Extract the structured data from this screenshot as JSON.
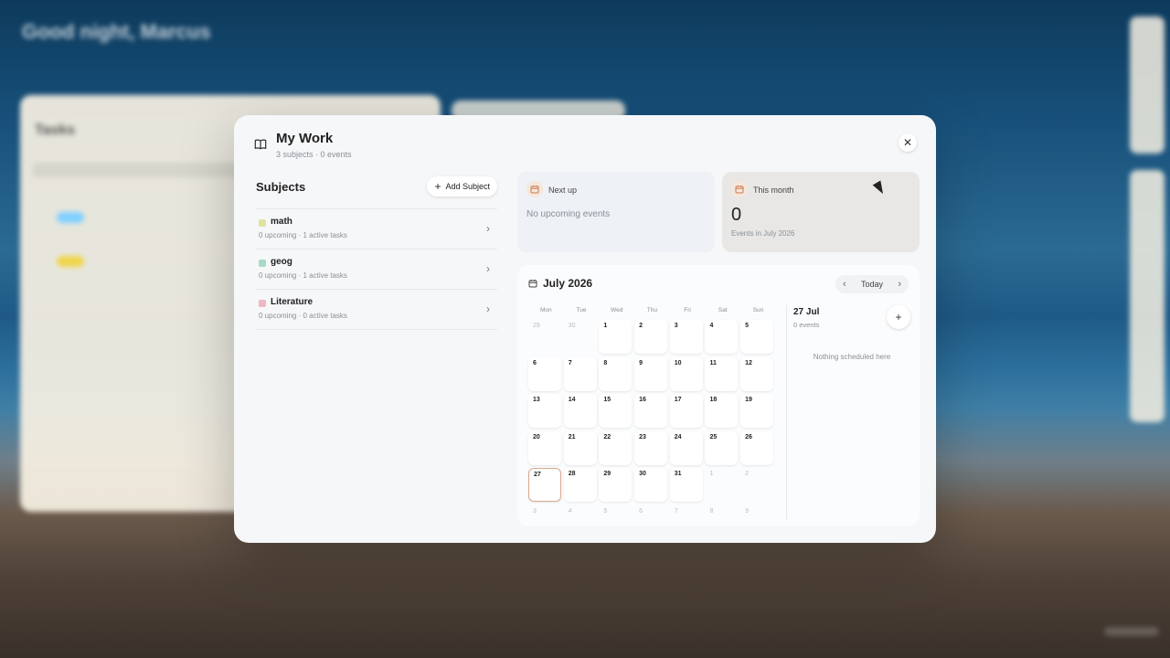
{
  "background": {
    "greeting": "Good night, Marcus",
    "subtitle": "",
    "card_title": "Tasks"
  },
  "modal": {
    "title": "My Work",
    "subtitle": "3 subjects · 0 events",
    "close_icon": "close-icon",
    "book_icon": "book-icon"
  },
  "subjects": {
    "heading": "Subjects",
    "add_label": "Add Subject",
    "items": [
      {
        "name": "math",
        "meta": "0 upcoming · 1 active tasks",
        "color": "#dfe3a0"
      },
      {
        "name": "geog",
        "meta": "0 upcoming · 1 active tasks",
        "color": "#a9d9c5"
      },
      {
        "name": "Literature",
        "meta": "0 upcoming · 0 active tasks",
        "color": "#efb6c3"
      }
    ]
  },
  "next_up": {
    "label": "Next up",
    "empty": "No upcoming events"
  },
  "this_month": {
    "label": "This month",
    "value": "0",
    "caption": "Events in July 2026"
  },
  "calendar": {
    "month": "July 2026",
    "today_label": "Today",
    "dows": [
      "Mon",
      "Tue",
      "Wed",
      "Thu",
      "Fri",
      "Sat",
      "Sun"
    ],
    "days": [
      {
        "d": "29",
        "out": true
      },
      {
        "d": "30",
        "out": true
      },
      {
        "d": "1"
      },
      {
        "d": "2"
      },
      {
        "d": "3"
      },
      {
        "d": "4"
      },
      {
        "d": "5"
      },
      {
        "d": "6"
      },
      {
        "d": "7"
      },
      {
        "d": "8"
      },
      {
        "d": "9"
      },
      {
        "d": "10"
      },
      {
        "d": "11"
      },
      {
        "d": "12"
      },
      {
        "d": "13"
      },
      {
        "d": "14"
      },
      {
        "d": "15"
      },
      {
        "d": "16"
      },
      {
        "d": "17"
      },
      {
        "d": "18"
      },
      {
        "d": "19"
      },
      {
        "d": "20"
      },
      {
        "d": "21"
      },
      {
        "d": "22"
      },
      {
        "d": "23"
      },
      {
        "d": "24"
      },
      {
        "d": "25"
      },
      {
        "d": "26"
      },
      {
        "d": "27",
        "today": true
      },
      {
        "d": "28"
      },
      {
        "d": "29"
      },
      {
        "d": "30"
      },
      {
        "d": "31"
      },
      {
        "d": "1",
        "out": true
      },
      {
        "d": "2",
        "out": true
      },
      {
        "d": "3",
        "out": true
      },
      {
        "d": "4",
        "out": true
      },
      {
        "d": "5",
        "out": true
      },
      {
        "d": "6",
        "out": true
      },
      {
        "d": "7",
        "out": true
      },
      {
        "d": "8",
        "out": true
      },
      {
        "d": "9",
        "out": true
      }
    ]
  },
  "day_panel": {
    "date": "27 Jul",
    "count": "0 events",
    "empty": "Nothing scheduled here"
  },
  "colors": {
    "accent": "#d9a98f",
    "icon_bg": "#f6e7dc"
  }
}
